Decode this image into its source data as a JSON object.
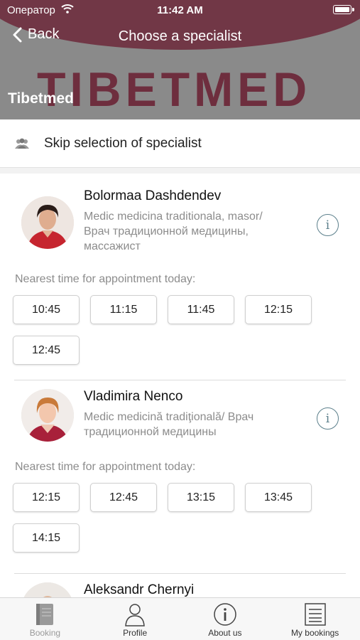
{
  "status_bar": {
    "carrier": "Оператор",
    "time": "11:42 AM"
  },
  "nav": {
    "back_label": "Back",
    "title": "Choose a specialist"
  },
  "brand": {
    "logo_text": "TIBETMED",
    "subtitle": "Tibetmed",
    "accent": "#6e2e3e"
  },
  "skip": {
    "label": "Skip selection of specialist",
    "icon": "group-icon"
  },
  "specialists": [
    {
      "name": "Bolormaa Dashdendev",
      "role_lines": [
        "Medic medicina traditionala, masor/",
        "Врач традиционной медицины,",
        "массажист"
      ],
      "nearest_label": "Nearest time for appointment today:",
      "slots": [
        "10:45",
        "11:15",
        "11:45",
        "12:15",
        "12:45"
      ]
    },
    {
      "name": "Vladimira Nenco",
      "role_lines": [
        "Medic medicină tradiţională/ Врач",
        "традиционной медицины"
      ],
      "nearest_label": "Nearest time for appointment today:",
      "slots": [
        "12:15",
        "12:45",
        "13:15",
        "13:45",
        "14:15"
      ]
    },
    {
      "name": "Aleksandr Chernyi"
    }
  ],
  "tabs": [
    {
      "label": "Booking",
      "icon": "book-icon",
      "active": true
    },
    {
      "label": "Profile",
      "icon": "person-icon",
      "active": false
    },
    {
      "label": "About us",
      "icon": "info-icon",
      "active": false
    },
    {
      "label": "My bookings",
      "icon": "list-icon",
      "active": false
    }
  ]
}
